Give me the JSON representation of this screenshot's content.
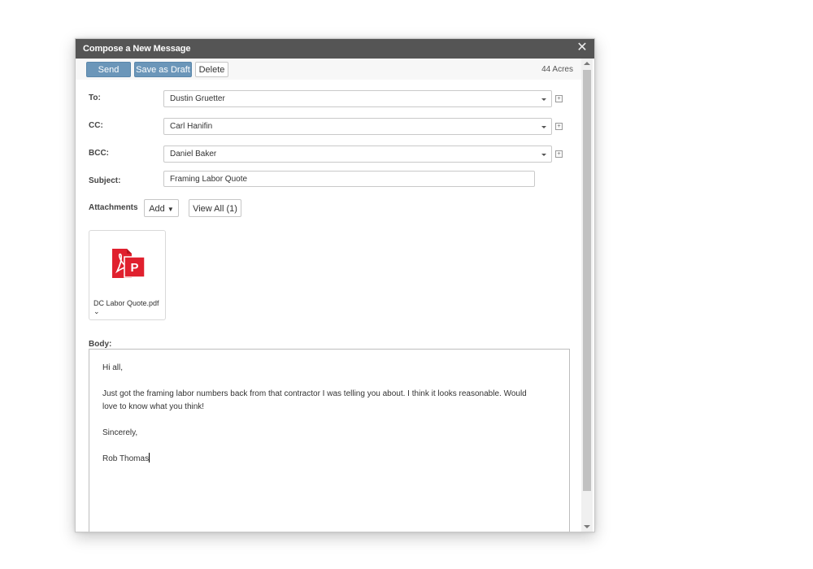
{
  "dialog": {
    "title": "Compose a New Message",
    "close_icon": "close-icon"
  },
  "toolbar": {
    "send_label": "Send",
    "save_draft_label": "Save as Draft",
    "delete_label": "Delete",
    "acres": "44 Acres"
  },
  "form": {
    "to_label": "To:",
    "to_value": "Dustin Gruetter",
    "cc_label": "CC:",
    "cc_value": "Carl Hanifin",
    "bcc_label": "BCC:",
    "bcc_value": "Daniel Baker",
    "subject_label": "Subject:",
    "subject_value": "Framing Labor Quote",
    "expand_icon": "plus-box-icon",
    "dropdown_icon": "caret-down-icon"
  },
  "attachments": {
    "label": "Attachments",
    "add_label": "Add",
    "view_all_label": "View All (1)",
    "files": [
      {
        "name": "DC Labor Quote.pdf",
        "icon": "pdf-icon"
      }
    ]
  },
  "body": {
    "label": "Body:",
    "greeting": "Hi all,",
    "line1": "Just got the framing labor numbers back from that contractor I was telling you about. I think it looks reasonable. Would",
    "line2": "love to know what you think!",
    "closing": "Sincerely,",
    "signature": "Rob Thomas"
  },
  "colors": {
    "titlebar": "#555555",
    "primary_button": "#6b96b9",
    "pdf_red": "#e0202e"
  }
}
